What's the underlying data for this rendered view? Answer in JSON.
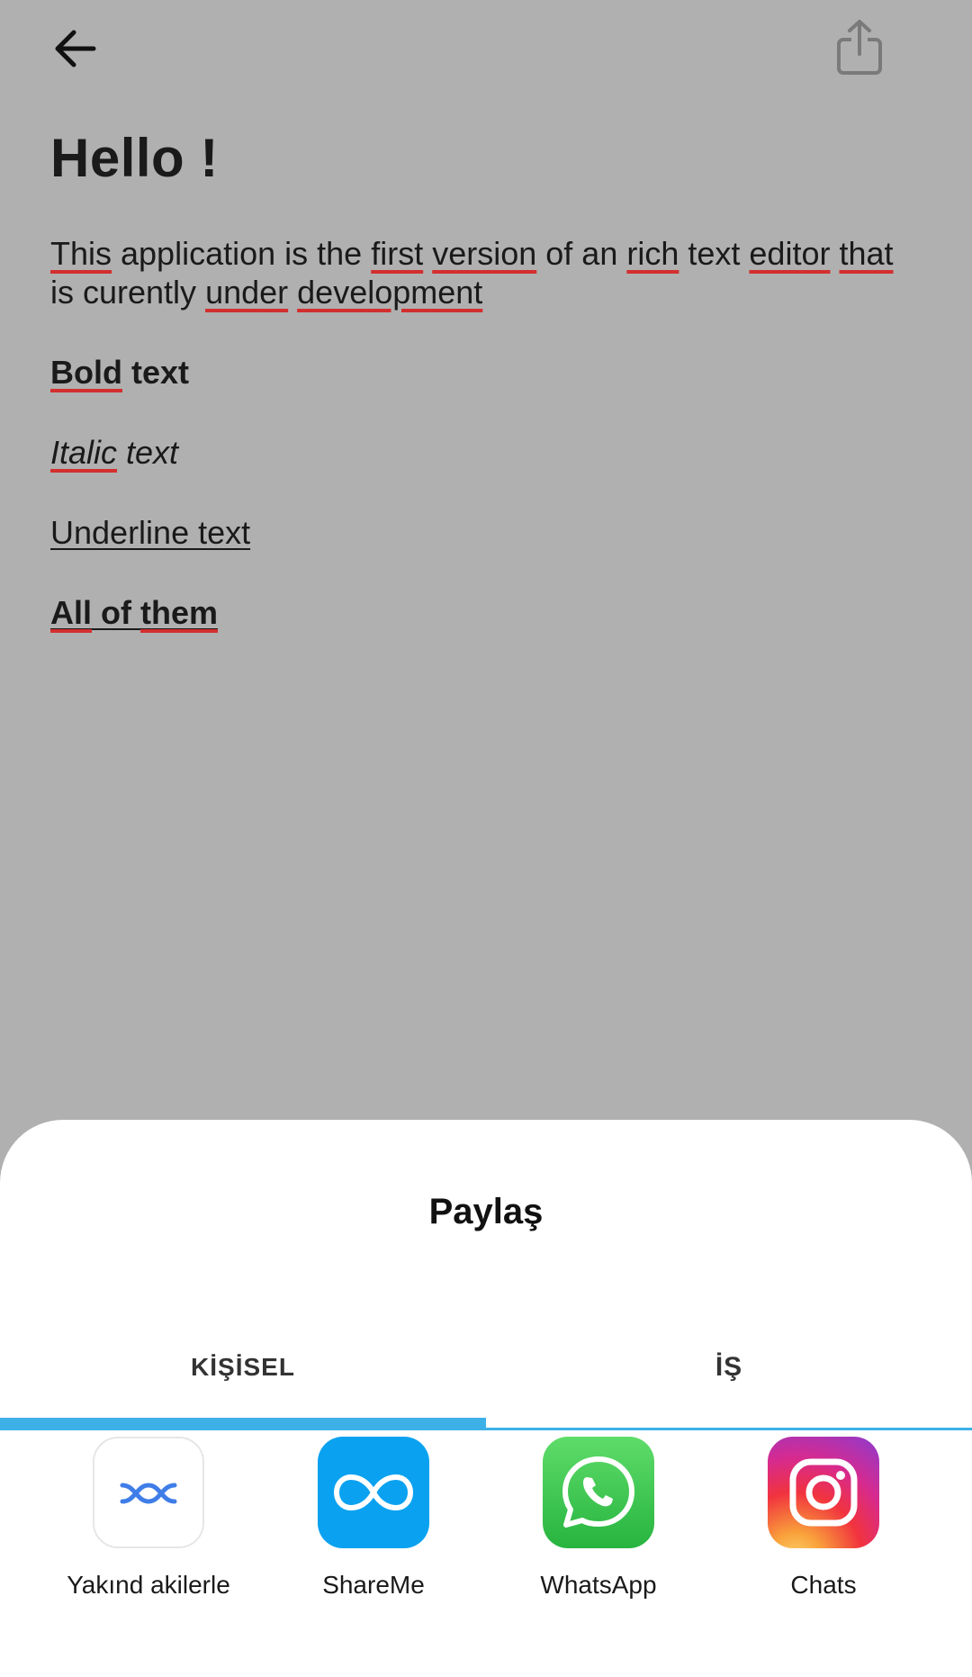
{
  "editor": {
    "heading": "Hello !",
    "paragraph": {
      "w1": "This",
      "t1": " application is the ",
      "w2": "first",
      "t2": " ",
      "w3": "version",
      "t3": " of an ",
      "w4": "rich",
      "t4": " text ",
      "w5": "editor",
      "t5": " ",
      "w6": "that",
      "t6": " is curently ",
      "w7": "under",
      "t7": " ",
      "w8": "development"
    },
    "bold_line": {
      "w1": "Bold",
      "t1": " text"
    },
    "italic_line": {
      "w1": "Italic",
      "t1": " text"
    },
    "underline_line": "Underline text",
    "all_line": {
      "w1": "All",
      "t1": " of ",
      "w2": "them"
    }
  },
  "share_sheet": {
    "title": "Paylaş",
    "tabs": [
      {
        "label": "KİŞİSEL",
        "active": true
      },
      {
        "label": "İŞ",
        "active": false
      }
    ],
    "apps": [
      {
        "label": "Yakınd akilerle",
        "icon": "nearby-share-icon"
      },
      {
        "label": "ShareMe",
        "icon": "shareme-icon"
      },
      {
        "label": "WhatsApp",
        "icon": "whatsapp-icon"
      },
      {
        "label": "Chats",
        "icon": "instagram-icon"
      }
    ]
  },
  "colors": {
    "dim_background": "#b0b0b0",
    "accent": "#3db0e8",
    "spellcheck": "#d32f2f"
  }
}
